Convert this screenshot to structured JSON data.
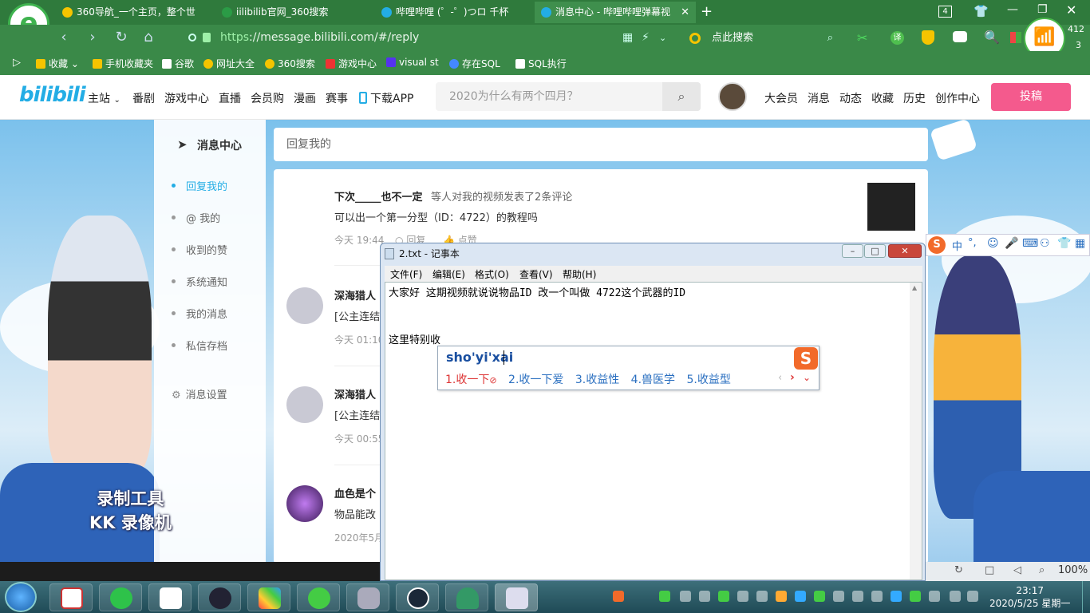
{
  "browser": {
    "tabs": [
      {
        "label": "360导航_一个主页，整个世",
        "color": "#f5c400"
      },
      {
        "label": "iilibilib官网_360搜索",
        "color": "#2b9b46"
      },
      {
        "label": "哔哩哔哩 (゜-゜)つロ 千杯",
        "color": "#23ade5"
      },
      {
        "label": "消息中心 - 哔哩哔哩弹幕视",
        "color": "#23ade5"
      }
    ],
    "tab_count": "4",
    "url_scheme": "https",
    "url_rest": "://message.bilibili.com/#/reply",
    "search_label": "点此搜索",
    "wifi_speed": "412",
    "wifi_count": "3",
    "bookmarks": [
      "收藏",
      "手机收藏夹",
      "谷歌",
      "网址大全",
      "360搜索",
      "游戏中心",
      "visual st",
      "存在SQL",
      "SQL执行"
    ]
  },
  "bili": {
    "logo": "bilibili",
    "nav": [
      "主站",
      "番剧",
      "游戏中心",
      "直播",
      "会员购",
      "漫画",
      "赛事",
      "下载APP"
    ],
    "search_placeholder": "2020为什么有两个四月？",
    "user_nav": [
      "大会员",
      "消息",
      "动态",
      "收藏",
      "历史",
      "创作中心"
    ],
    "upload_label": "投稿"
  },
  "sidebar": {
    "title": "消息中心",
    "items": [
      "回复我的",
      "@ 我的",
      "收到的赞",
      "系统通知",
      "我的消息",
      "私信存档"
    ],
    "settings": "消息设置"
  },
  "main": {
    "header": "回复我的",
    "comments": [
      {
        "user": "下次_____也不一定",
        "action": "等人对我的视频发表了2条评论",
        "text": "可以出一个第一分型（ID：4722）的教程吗",
        "time": "今天 19:44",
        "reply": "回复",
        "like": "点赞"
      },
      {
        "user": "深海猎人",
        "text": "[公主连结",
        "time": "今天 01:10"
      },
      {
        "user": "深海猎人",
        "text": "[公主连结",
        "time": "今天 00:55"
      },
      {
        "user": "血色是个",
        "text": "物品能改",
        "time": "2020年5月"
      }
    ]
  },
  "watermark": {
    "line1": "录制工具",
    "line2": "KK 录像机"
  },
  "notepad": {
    "title": "2.txt - 记事本",
    "menu": [
      "文件(F)",
      "编辑(E)",
      "格式(O)",
      "查看(V)",
      "帮助(H)"
    ],
    "line1": "大家好   这期视频就说说物品ID 改一个叫做  4722这个武器的ID",
    "line2": "这里特别收"
  },
  "ime": {
    "input": "sho'yi'xai",
    "candidates": [
      "1.收一下",
      "2.收一下爱",
      "3.收益性",
      "4.兽医学",
      "5.收益型"
    ],
    "bar_lang": "中"
  },
  "statusbar": {
    "zoom": "100%"
  },
  "taskbar": {
    "time": "23:17",
    "date": "2020/5/25 星期一"
  }
}
